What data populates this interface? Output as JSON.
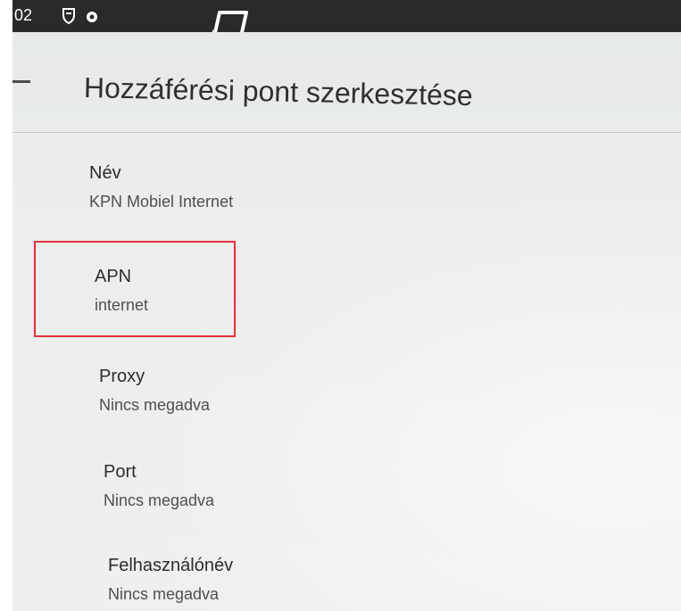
{
  "status_bar": {
    "time": "02",
    "icons": [
      "shield-icon",
      "notification-blob-icon",
      "screen-rotate-icon"
    ]
  },
  "toolbar": {
    "title": "Hozzáférési pont szerkesztése",
    "back_icon": "back-arrow-icon"
  },
  "preferences": [
    {
      "key": "name",
      "title": "Név",
      "summary": "KPN Mobiel Internet"
    },
    {
      "key": "apn",
      "title": "APN",
      "summary": "internet"
    },
    {
      "key": "proxy",
      "title": "Proxy",
      "summary": "Nincs megadva"
    },
    {
      "key": "port",
      "title": "Port",
      "summary": "Nincs megadva"
    },
    {
      "key": "username",
      "title": "Felhasználónév",
      "summary": "Nincs megadva"
    }
  ],
  "colors": {
    "highlight": "#e0323c",
    "status_bar": "#2a2a2a",
    "background": "#eceeec"
  }
}
